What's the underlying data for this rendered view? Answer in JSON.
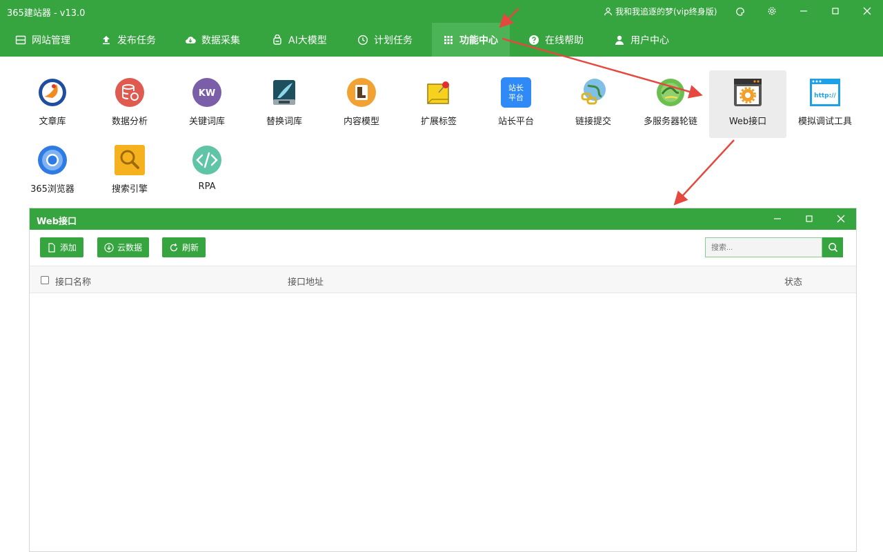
{
  "window": {
    "title": "365建站器 - v13.0",
    "user": "我和我追逐的梦(vip终身版)"
  },
  "nav": {
    "items": [
      {
        "label": "网站管理",
        "icon": "website-icon"
      },
      {
        "label": "发布任务",
        "icon": "upload-icon"
      },
      {
        "label": "数据采集",
        "icon": "cloud-download-icon"
      },
      {
        "label": "AI大模型",
        "icon": "robot-icon"
      },
      {
        "label": "计划任务",
        "icon": "clock-icon"
      },
      {
        "label": "功能中心",
        "icon": "grid-icon",
        "active": true
      },
      {
        "label": "在线帮助",
        "icon": "help-icon"
      },
      {
        "label": "用户中心",
        "icon": "user-icon"
      }
    ]
  },
  "features": {
    "items": [
      {
        "label": "文章库",
        "icon": "article-library-icon"
      },
      {
        "label": "数据分析",
        "icon": "data-analysis-icon"
      },
      {
        "label": "关键词库",
        "icon": "keyword-library-icon",
        "glyph": "KW"
      },
      {
        "label": "替换词库",
        "icon": "replace-library-icon"
      },
      {
        "label": "内容模型",
        "icon": "content-model-icon"
      },
      {
        "label": "扩展标签",
        "icon": "extension-tag-icon"
      },
      {
        "label": "站长平台",
        "icon": "webmaster-platform-icon",
        "glyph": "站长\n平台"
      },
      {
        "label": "链接提交",
        "icon": "link-submit-icon"
      },
      {
        "label": "多服务器轮链",
        "icon": "multi-server-icon"
      },
      {
        "label": "Web接口",
        "icon": "web-api-icon",
        "selected": true
      },
      {
        "label": "模拟调试工具",
        "icon": "http-debug-icon",
        "glyph": "http://"
      },
      {
        "label": "365浏览器",
        "icon": "browser-icon"
      },
      {
        "label": "搜索引擎",
        "icon": "search-engine-icon"
      },
      {
        "label": "RPA",
        "icon": "rpa-icon"
      }
    ]
  },
  "dialog": {
    "title": "Web接口",
    "buttons": {
      "add": "添加",
      "cloud": "云数据",
      "refresh": "刷新"
    },
    "search_placeholder": "搜索...",
    "columns": [
      "接口名称",
      "接口地址",
      "状态"
    ]
  },
  "colors": {
    "primary": "#36a53f",
    "active_tab": "#4cb456",
    "annotation_arrow": "#e5483f"
  }
}
